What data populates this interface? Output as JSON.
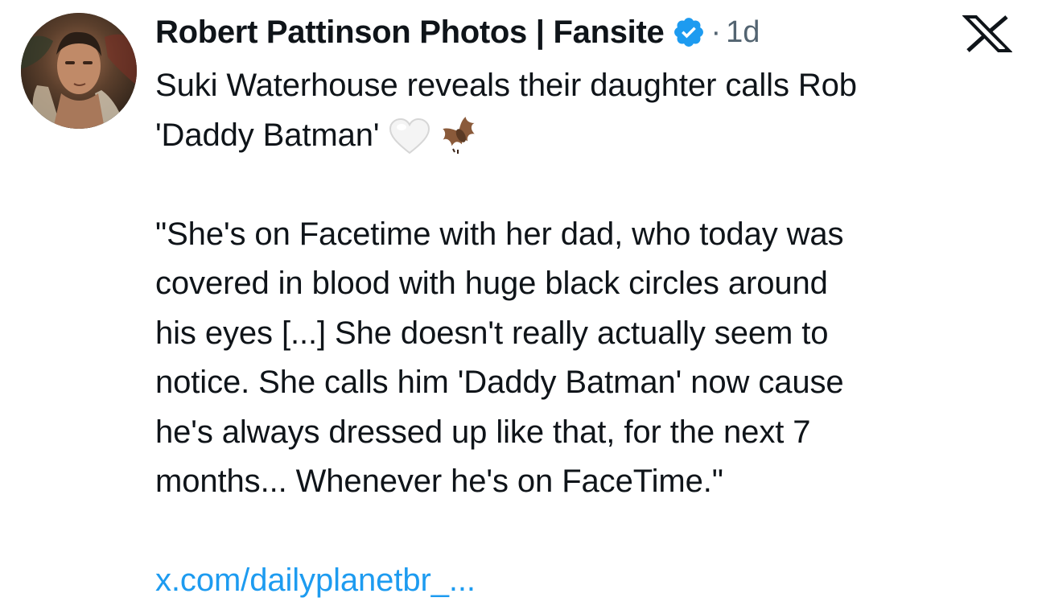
{
  "tweet": {
    "author": {
      "display_name": "Robert Pattinson Photos | Fansite",
      "verified": true,
      "avatar_icon": "profile-photo"
    },
    "separator": "·",
    "timestamp": "1d",
    "platform_icon": "x-logo-icon",
    "text_lines": [
      "Suki Waterhouse reveals their daughter calls Rob",
      "'Daddy Batman'"
    ],
    "emojis": [
      "white-heart-icon",
      "bat-icon"
    ],
    "quote_lines": [
      "\"She's on Facetime with her dad, who today was",
      "covered in blood with huge black circles around",
      "his eyes [...] She doesn't really actually seem to",
      "notice. She calls him 'Daddy Batman' now cause",
      "he's always dressed up like that, for the next 7",
      "months... Whenever he's on FaceTime.\""
    ],
    "link": "x.com/dailyplanetbr_..."
  },
  "colors": {
    "text": "#0f1419",
    "secondary": "#536471",
    "link": "#1d9bf0",
    "verified": "#1d9bf0"
  }
}
